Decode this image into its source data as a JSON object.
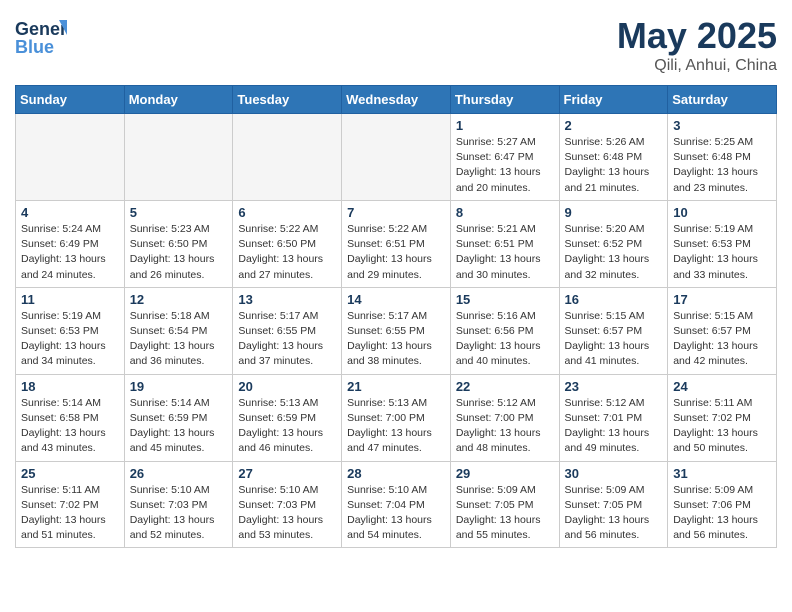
{
  "header": {
    "logo_line1": "General",
    "logo_line2": "Blue",
    "month_year": "May 2025",
    "location": "Qili, Anhui, China"
  },
  "weekdays": [
    "Sunday",
    "Monday",
    "Tuesday",
    "Wednesday",
    "Thursday",
    "Friday",
    "Saturday"
  ],
  "weeks": [
    [
      {
        "day": "",
        "info": ""
      },
      {
        "day": "",
        "info": ""
      },
      {
        "day": "",
        "info": ""
      },
      {
        "day": "",
        "info": ""
      },
      {
        "day": "1",
        "info": "Sunrise: 5:27 AM\nSunset: 6:47 PM\nDaylight: 13 hours\nand 20 minutes."
      },
      {
        "day": "2",
        "info": "Sunrise: 5:26 AM\nSunset: 6:48 PM\nDaylight: 13 hours\nand 21 minutes."
      },
      {
        "day": "3",
        "info": "Sunrise: 5:25 AM\nSunset: 6:48 PM\nDaylight: 13 hours\nand 23 minutes."
      }
    ],
    [
      {
        "day": "4",
        "info": "Sunrise: 5:24 AM\nSunset: 6:49 PM\nDaylight: 13 hours\nand 24 minutes."
      },
      {
        "day": "5",
        "info": "Sunrise: 5:23 AM\nSunset: 6:50 PM\nDaylight: 13 hours\nand 26 minutes."
      },
      {
        "day": "6",
        "info": "Sunrise: 5:22 AM\nSunset: 6:50 PM\nDaylight: 13 hours\nand 27 minutes."
      },
      {
        "day": "7",
        "info": "Sunrise: 5:22 AM\nSunset: 6:51 PM\nDaylight: 13 hours\nand 29 minutes."
      },
      {
        "day": "8",
        "info": "Sunrise: 5:21 AM\nSunset: 6:51 PM\nDaylight: 13 hours\nand 30 minutes."
      },
      {
        "day": "9",
        "info": "Sunrise: 5:20 AM\nSunset: 6:52 PM\nDaylight: 13 hours\nand 32 minutes."
      },
      {
        "day": "10",
        "info": "Sunrise: 5:19 AM\nSunset: 6:53 PM\nDaylight: 13 hours\nand 33 minutes."
      }
    ],
    [
      {
        "day": "11",
        "info": "Sunrise: 5:19 AM\nSunset: 6:53 PM\nDaylight: 13 hours\nand 34 minutes."
      },
      {
        "day": "12",
        "info": "Sunrise: 5:18 AM\nSunset: 6:54 PM\nDaylight: 13 hours\nand 36 minutes."
      },
      {
        "day": "13",
        "info": "Sunrise: 5:17 AM\nSunset: 6:55 PM\nDaylight: 13 hours\nand 37 minutes."
      },
      {
        "day": "14",
        "info": "Sunrise: 5:17 AM\nSunset: 6:55 PM\nDaylight: 13 hours\nand 38 minutes."
      },
      {
        "day": "15",
        "info": "Sunrise: 5:16 AM\nSunset: 6:56 PM\nDaylight: 13 hours\nand 40 minutes."
      },
      {
        "day": "16",
        "info": "Sunrise: 5:15 AM\nSunset: 6:57 PM\nDaylight: 13 hours\nand 41 minutes."
      },
      {
        "day": "17",
        "info": "Sunrise: 5:15 AM\nSunset: 6:57 PM\nDaylight: 13 hours\nand 42 minutes."
      }
    ],
    [
      {
        "day": "18",
        "info": "Sunrise: 5:14 AM\nSunset: 6:58 PM\nDaylight: 13 hours\nand 43 minutes."
      },
      {
        "day": "19",
        "info": "Sunrise: 5:14 AM\nSunset: 6:59 PM\nDaylight: 13 hours\nand 45 minutes."
      },
      {
        "day": "20",
        "info": "Sunrise: 5:13 AM\nSunset: 6:59 PM\nDaylight: 13 hours\nand 46 minutes."
      },
      {
        "day": "21",
        "info": "Sunrise: 5:13 AM\nSunset: 7:00 PM\nDaylight: 13 hours\nand 47 minutes."
      },
      {
        "day": "22",
        "info": "Sunrise: 5:12 AM\nSunset: 7:00 PM\nDaylight: 13 hours\nand 48 minutes."
      },
      {
        "day": "23",
        "info": "Sunrise: 5:12 AM\nSunset: 7:01 PM\nDaylight: 13 hours\nand 49 minutes."
      },
      {
        "day": "24",
        "info": "Sunrise: 5:11 AM\nSunset: 7:02 PM\nDaylight: 13 hours\nand 50 minutes."
      }
    ],
    [
      {
        "day": "25",
        "info": "Sunrise: 5:11 AM\nSunset: 7:02 PM\nDaylight: 13 hours\nand 51 minutes."
      },
      {
        "day": "26",
        "info": "Sunrise: 5:10 AM\nSunset: 7:03 PM\nDaylight: 13 hours\nand 52 minutes."
      },
      {
        "day": "27",
        "info": "Sunrise: 5:10 AM\nSunset: 7:03 PM\nDaylight: 13 hours\nand 53 minutes."
      },
      {
        "day": "28",
        "info": "Sunrise: 5:10 AM\nSunset: 7:04 PM\nDaylight: 13 hours\nand 54 minutes."
      },
      {
        "day": "29",
        "info": "Sunrise: 5:09 AM\nSunset: 7:05 PM\nDaylight: 13 hours\nand 55 minutes."
      },
      {
        "day": "30",
        "info": "Sunrise: 5:09 AM\nSunset: 7:05 PM\nDaylight: 13 hours\nand 56 minutes."
      },
      {
        "day": "31",
        "info": "Sunrise: 5:09 AM\nSunset: 7:06 PM\nDaylight: 13 hours\nand 56 minutes."
      }
    ]
  ]
}
